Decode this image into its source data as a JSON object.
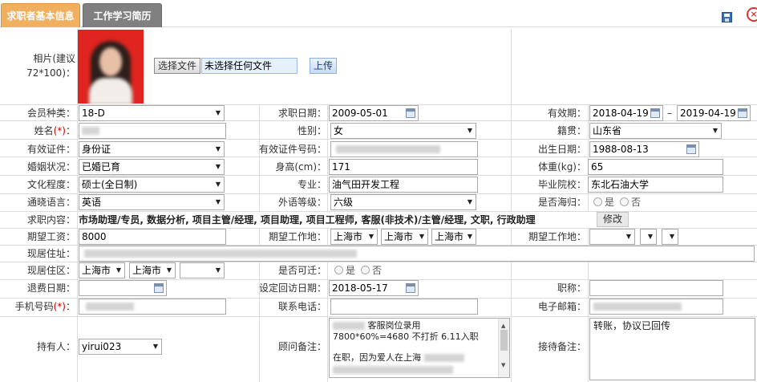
{
  "tabs": {
    "active": "求职者基本信息",
    "inactive": "工作学习简历"
  },
  "photo": {
    "label": "相片(建议72*100)：",
    "file_button": "选择文件",
    "file_name": "未选择任何文件",
    "upload_button": "上传"
  },
  "fields": {
    "member_type": {
      "label": "会员种类：",
      "value": "18-D"
    },
    "apply_date": {
      "label": "求职日期：",
      "value": "2009-05-01"
    },
    "valid_period": {
      "label": "有效期：",
      "start": "2018-04-19",
      "separator": "–",
      "end": "2019-04-19"
    },
    "name": {
      "label": "姓名",
      "required_mark": "(*)",
      "colon": "："
    },
    "gender": {
      "label": "性别：",
      "value": "女"
    },
    "native_place": {
      "label": "籍贯：",
      "value": "山东省"
    },
    "id_type": {
      "label": "有效证件：",
      "value": "身份证"
    },
    "id_number": {
      "label": "有效证件号码："
    },
    "birth_date": {
      "label": "出生日期：",
      "value": "1988-08-13"
    },
    "marital": {
      "label": "婚姻状况：",
      "value": "已婚已育"
    },
    "height": {
      "label": "身高(cm)：",
      "value": "171"
    },
    "weight": {
      "label": "体重(kg)：",
      "value": "65"
    },
    "education": {
      "label": "文化程度：",
      "value": "硕士(全日制)"
    },
    "major": {
      "label": "专业：",
      "value": "油气田开发工程"
    },
    "school": {
      "label": "毕业院校：",
      "value": "东北石油大学"
    },
    "language": {
      "label": "通晓语言：",
      "value": "英语"
    },
    "language_level": {
      "label": "外语等级：",
      "value": "六级"
    },
    "returnee": {
      "label": "是否海归：",
      "yes": "是",
      "no": "否"
    },
    "job_content": {
      "label": "求职内容：",
      "value": "市场助理/专员, 数据分析, 项目主管/经理, 项目助理, 项目工程师, 客服(非技术)/主管/经理, 文职, 行政助理",
      "edit_button": "修改"
    },
    "salary": {
      "label": "期望工资：",
      "value": "8000"
    },
    "work_place": {
      "label": "期望工作地：",
      "province": "上海市",
      "city": "上海市",
      "district": "上海市"
    },
    "work_place2": {
      "label": "期望工作地："
    },
    "address": {
      "label": "现居住址："
    },
    "residence": {
      "label": "现居住区：",
      "province": "上海市",
      "city": "上海市"
    },
    "relocate": {
      "label": "是否可迁：",
      "yes": "是",
      "no": "否"
    },
    "refund_date": {
      "label": "退费日期："
    },
    "revisit_date": {
      "label": "设定回访日期：",
      "value": "2018-05-17"
    },
    "title": {
      "label": "职称："
    },
    "mobile": {
      "label": "手机号码",
      "required_mark": "(*)",
      "colon": "："
    },
    "phone": {
      "label": "联系电话："
    },
    "email": {
      "label": "电子邮箱："
    },
    "holder": {
      "label": "持有人：",
      "value": "yirui023"
    },
    "advisor_note": {
      "label": "顾问备注：",
      "line1": "客服岗位录用",
      "line2": "7800*60%=4680  不打折 6.11入职",
      "line3": "在职，因为爱人在上海"
    },
    "reception_note": {
      "label": "接待备注：",
      "value": "转账，协议已回传"
    }
  }
}
